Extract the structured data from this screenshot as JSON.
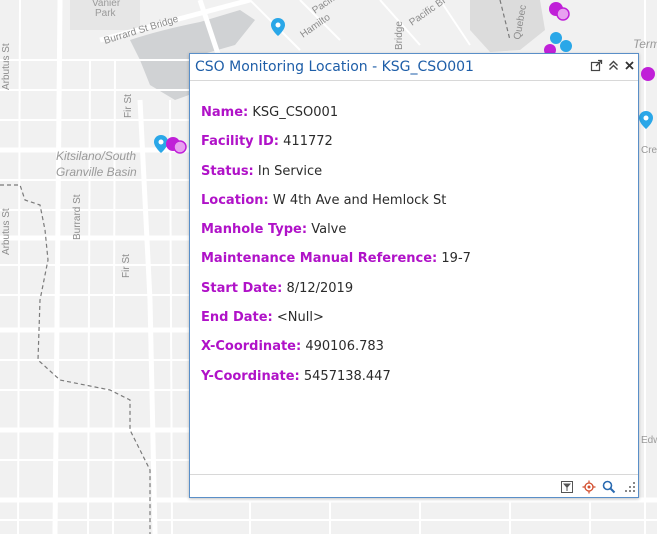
{
  "map": {
    "area_label_line1": "Kitsilano/South",
    "area_label_line2": "Granville Basin",
    "park_label_line1": "Vanier",
    "park_label_line2": "Park",
    "term_label": "Term",
    "creat_label": "Creat",
    "edw_label": "Edw",
    "streets": {
      "burrard_st_bridge": "Burrard St Bridge",
      "arbutus_st_1": "Arbutus St",
      "arbutus_st_2": "Arbutus St",
      "burrard_st": "Burrard St",
      "fir_st_1": "Fir St",
      "fir_st_2": "Fir St",
      "hamilton": "Hamilto",
      "pacific_bl": "Pacific Bl",
      "pacific": "Pacific",
      "quebec": "Quebec",
      "bridge": "Bridge"
    }
  },
  "popup": {
    "title": "CSO Monitoring Location - KSG_CSO001",
    "fields": [
      {
        "label": "Name:",
        "value": "KSG_CSO001"
      },
      {
        "label": "Facility ID:",
        "value": "411772"
      },
      {
        "label": "Status:",
        "value": "In Service"
      },
      {
        "label": "Location:",
        "value": "W 4th Ave and Hemlock St"
      },
      {
        "label": "Manhole Type:",
        "value": "Valve"
      },
      {
        "label": "Maintenance Manual Reference:",
        "value": "19-7"
      },
      {
        "label": "Start Date:",
        "value": "8/12/2019"
      },
      {
        "label": "End Date:",
        "value": "<Null>"
      },
      {
        "label": "X-Coordinate:",
        "value": "490106.783"
      },
      {
        "label": "Y-Coordinate:",
        "value": "5457138.447"
      }
    ]
  },
  "colors": {
    "title": "#1e5ea8",
    "field_label": "#b012c8",
    "pin_blue": "#2aa7e8",
    "pin_magenta": "#c020d8"
  }
}
